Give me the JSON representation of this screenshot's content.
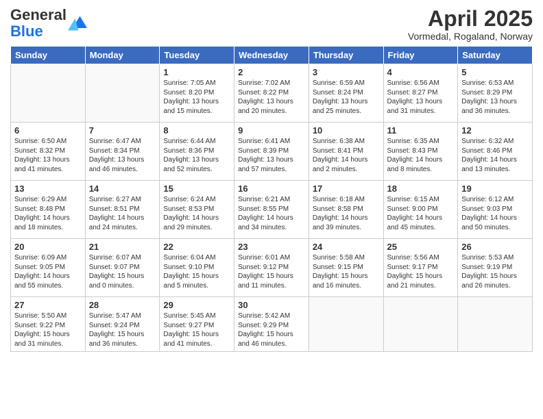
{
  "logo": {
    "general": "General",
    "blue": "Blue"
  },
  "title": "April 2025",
  "subtitle": "Vormedal, Rogaland, Norway",
  "days_of_week": [
    "Sunday",
    "Monday",
    "Tuesday",
    "Wednesday",
    "Thursday",
    "Friday",
    "Saturday"
  ],
  "weeks": [
    [
      {
        "day": "",
        "info": ""
      },
      {
        "day": "",
        "info": ""
      },
      {
        "day": "1",
        "info": "Sunrise: 7:05 AM\nSunset: 8:20 PM\nDaylight: 13 hours and 15 minutes."
      },
      {
        "day": "2",
        "info": "Sunrise: 7:02 AM\nSunset: 8:22 PM\nDaylight: 13 hours and 20 minutes."
      },
      {
        "day": "3",
        "info": "Sunrise: 6:59 AM\nSunset: 8:24 PM\nDaylight: 13 hours and 25 minutes."
      },
      {
        "day": "4",
        "info": "Sunrise: 6:56 AM\nSunset: 8:27 PM\nDaylight: 13 hours and 31 minutes."
      },
      {
        "day": "5",
        "info": "Sunrise: 6:53 AM\nSunset: 8:29 PM\nDaylight: 13 hours and 36 minutes."
      }
    ],
    [
      {
        "day": "6",
        "info": "Sunrise: 6:50 AM\nSunset: 8:32 PM\nDaylight: 13 hours and 41 minutes."
      },
      {
        "day": "7",
        "info": "Sunrise: 6:47 AM\nSunset: 8:34 PM\nDaylight: 13 hours and 46 minutes."
      },
      {
        "day": "8",
        "info": "Sunrise: 6:44 AM\nSunset: 8:36 PM\nDaylight: 13 hours and 52 minutes."
      },
      {
        "day": "9",
        "info": "Sunrise: 6:41 AM\nSunset: 8:39 PM\nDaylight: 13 hours and 57 minutes."
      },
      {
        "day": "10",
        "info": "Sunrise: 6:38 AM\nSunset: 8:41 PM\nDaylight: 14 hours and 2 minutes."
      },
      {
        "day": "11",
        "info": "Sunrise: 6:35 AM\nSunset: 8:43 PM\nDaylight: 14 hours and 8 minutes."
      },
      {
        "day": "12",
        "info": "Sunrise: 6:32 AM\nSunset: 8:46 PM\nDaylight: 14 hours and 13 minutes."
      }
    ],
    [
      {
        "day": "13",
        "info": "Sunrise: 6:29 AM\nSunset: 8:48 PM\nDaylight: 14 hours and 18 minutes."
      },
      {
        "day": "14",
        "info": "Sunrise: 6:27 AM\nSunset: 8:51 PM\nDaylight: 14 hours and 24 minutes."
      },
      {
        "day": "15",
        "info": "Sunrise: 6:24 AM\nSunset: 8:53 PM\nDaylight: 14 hours and 29 minutes."
      },
      {
        "day": "16",
        "info": "Sunrise: 6:21 AM\nSunset: 8:55 PM\nDaylight: 14 hours and 34 minutes."
      },
      {
        "day": "17",
        "info": "Sunrise: 6:18 AM\nSunset: 8:58 PM\nDaylight: 14 hours and 39 minutes."
      },
      {
        "day": "18",
        "info": "Sunrise: 6:15 AM\nSunset: 9:00 PM\nDaylight: 14 hours and 45 minutes."
      },
      {
        "day": "19",
        "info": "Sunrise: 6:12 AM\nSunset: 9:03 PM\nDaylight: 14 hours and 50 minutes."
      }
    ],
    [
      {
        "day": "20",
        "info": "Sunrise: 6:09 AM\nSunset: 9:05 PM\nDaylight: 14 hours and 55 minutes."
      },
      {
        "day": "21",
        "info": "Sunrise: 6:07 AM\nSunset: 9:07 PM\nDaylight: 15 hours and 0 minutes."
      },
      {
        "day": "22",
        "info": "Sunrise: 6:04 AM\nSunset: 9:10 PM\nDaylight: 15 hours and 5 minutes."
      },
      {
        "day": "23",
        "info": "Sunrise: 6:01 AM\nSunset: 9:12 PM\nDaylight: 15 hours and 11 minutes."
      },
      {
        "day": "24",
        "info": "Sunrise: 5:58 AM\nSunset: 9:15 PM\nDaylight: 15 hours and 16 minutes."
      },
      {
        "day": "25",
        "info": "Sunrise: 5:56 AM\nSunset: 9:17 PM\nDaylight: 15 hours and 21 minutes."
      },
      {
        "day": "26",
        "info": "Sunrise: 5:53 AM\nSunset: 9:19 PM\nDaylight: 15 hours and 26 minutes."
      }
    ],
    [
      {
        "day": "27",
        "info": "Sunrise: 5:50 AM\nSunset: 9:22 PM\nDaylight: 15 hours and 31 minutes."
      },
      {
        "day": "28",
        "info": "Sunrise: 5:47 AM\nSunset: 9:24 PM\nDaylight: 15 hours and 36 minutes."
      },
      {
        "day": "29",
        "info": "Sunrise: 5:45 AM\nSunset: 9:27 PM\nDaylight: 15 hours and 41 minutes."
      },
      {
        "day": "30",
        "info": "Sunrise: 5:42 AM\nSunset: 9:29 PM\nDaylight: 15 hours and 46 minutes."
      },
      {
        "day": "",
        "info": ""
      },
      {
        "day": "",
        "info": ""
      },
      {
        "day": "",
        "info": ""
      }
    ]
  ]
}
